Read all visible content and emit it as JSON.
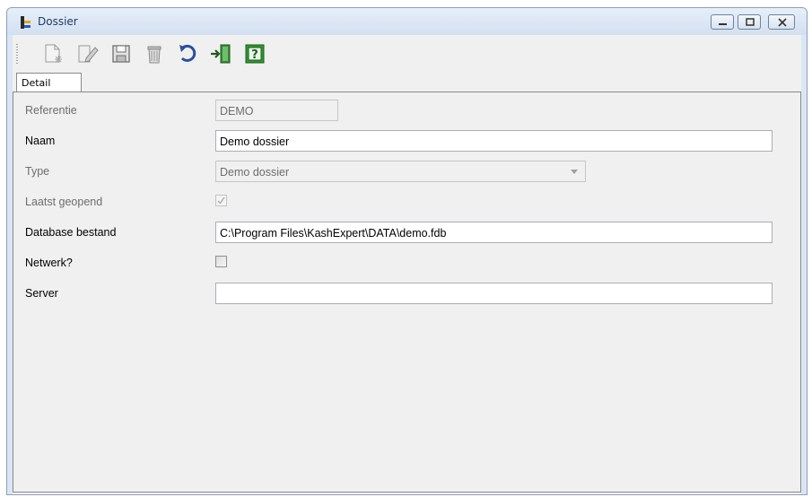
{
  "window": {
    "title": "Dossier"
  },
  "toolbar": {
    "items": [
      {
        "name": "new-document-icon",
        "enabled": false
      },
      {
        "name": "edit-icon",
        "enabled": false
      },
      {
        "name": "save-icon",
        "enabled": false
      },
      {
        "name": "delete-icon",
        "enabled": false
      },
      {
        "name": "refresh-icon",
        "enabled": true
      },
      {
        "name": "exit-door-icon",
        "enabled": true
      },
      {
        "name": "help-icon",
        "enabled": true
      }
    ]
  },
  "tabs": [
    {
      "label": "Detail",
      "active": true
    }
  ],
  "form": {
    "referentie": {
      "label": "Referentie",
      "value": "DEMO",
      "enabled": false
    },
    "naam": {
      "label": "Naam",
      "value": "Demo dossier",
      "enabled": true
    },
    "type": {
      "label": "Type",
      "value": "Demo dossier",
      "enabled": false
    },
    "laatst_geopend": {
      "label": "Laatst geopend",
      "checked": true,
      "enabled": false
    },
    "database_bestand": {
      "label": "Database bestand",
      "value": "C:\\Program Files\\KashExpert\\DATA\\demo.fdb",
      "enabled": true
    },
    "netwerk": {
      "label": "Netwerk?",
      "checked": false,
      "enabled": true
    },
    "server": {
      "label": "Server",
      "value": "",
      "enabled": true
    }
  },
  "colors": {
    "accent_green": "#2e9a2e",
    "title_text": "#1e395b"
  }
}
